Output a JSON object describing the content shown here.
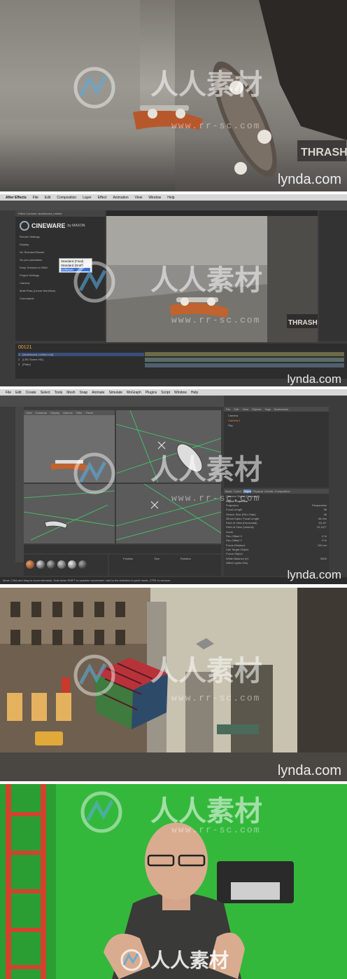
{
  "branding": {
    "lynda": "lynda.com",
    "watermark_cn": "人人素材",
    "watermark_url": "www.rr-sc.com"
  },
  "ae": {
    "menu": [
      "After Effects",
      "File",
      "Edit",
      "Composition",
      "Layer",
      "Effect",
      "Animation",
      "View",
      "Window",
      "Help"
    ],
    "effect_title": "Effect Controls: skateboard_melted",
    "plugin_name": "CINEWARE",
    "plugin_by": "by MAXON",
    "renderer_label": "Renderer",
    "renderer_options": [
      "Standard (Final)",
      "Standard (Draft)",
      "Software"
    ],
    "settings": [
      "Render Settings",
      "Display",
      "No Textures/Shader",
      "No pre-calculation",
      "Keep Textures in RAM",
      "Project Settings",
      "Camera",
      "Multi-Pass (Linear Workflow)",
      "Commands"
    ],
    "timecode": "00121",
    "layers": [
      {
        "num": "1",
        "name": "[skateboard_melted.c4d]"
      },
      {
        "num": "2",
        "name": "[LED Scene HD]"
      },
      {
        "num": "3",
        "name": "[Plate]"
      }
    ],
    "sign_text": "THRASH"
  },
  "c4d": {
    "menu": [
      "File",
      "Edit",
      "Create",
      "Select",
      "Tools",
      "Mesh",
      "Snap",
      "Animate",
      "Simulate",
      "MoGraph",
      "Plugins",
      "Script",
      "Window",
      "Help"
    ],
    "objects_menu": [
      "File",
      "Edit",
      "View",
      "Objects",
      "Tags",
      "Bookmarks"
    ],
    "objects": [
      "Camera",
      "Camera.1",
      "Sky"
    ],
    "viewport_menu": [
      "View",
      "Cameras",
      "Display",
      "Options",
      "Filter",
      "Panel"
    ],
    "attr_tabs": [
      "Basic",
      "Coord.",
      "Object",
      "Physical",
      "Details",
      "Composition"
    ],
    "attr_title": "Camera Object [Camera.1]",
    "attr_section": "Object Properties",
    "properties": [
      "Projection",
      "Focal Length",
      "Sensor Size (Film Gate)",
      "35mm Equiv. Focal Length",
      "Field of View (Horizontal)",
      "Field of View (Vertical)",
      "Zoom",
      "Film Offset X",
      "Film Offset Y",
      "Focus Distance",
      "Use Target Object",
      "Focus Object",
      "White Balance (K)",
      "Affect Lights Only"
    ],
    "values": [
      "Perspective",
      "36",
      "36",
      "36 mm",
      "53.13°",
      "31.417°",
      "",
      "0 %",
      "0 %",
      "190 cm",
      "",
      "",
      "5500",
      ""
    ],
    "coord_headers": [
      "Position",
      "Size",
      "Rotation"
    ],
    "status": "Move: Click and drag to move elements. Hold down SHIFT to quantize movement / add to the selection in point mode, CTRL to remove."
  },
  "colors": {
    "green_screen": "#2fb43a",
    "ladder": "#d1432c",
    "ui_dark": "#3a3a3a"
  }
}
